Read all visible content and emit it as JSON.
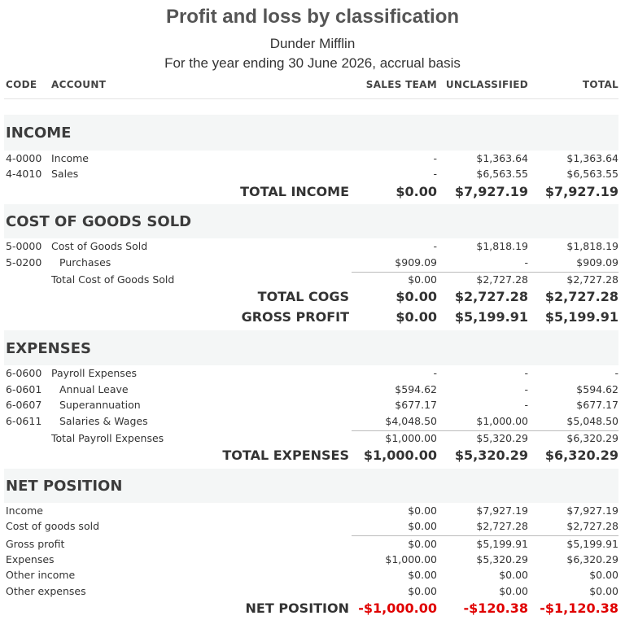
{
  "report": {
    "title": "Profit and loss by classification",
    "company": "Dunder Mifflin",
    "period": "For the year ending 30 June 2026, accrual basis"
  },
  "columns": {
    "code": "CODE",
    "account": "ACCOUNT",
    "sales_team": "SALES TEAM",
    "unclassified": "UNCLASSIFIED",
    "total": "TOTAL"
  },
  "income": {
    "title": "INCOME",
    "rows": [
      {
        "code": "4-0000",
        "account": "Income",
        "sales": "-",
        "uncl": "$1,363.64",
        "total": "$1,363.64"
      },
      {
        "code": "4-4010",
        "account": "Sales",
        "sales": "-",
        "uncl": "$6,563.55",
        "total": "$6,563.55"
      }
    ],
    "total": {
      "label": "TOTAL INCOME",
      "sales": "$0.00",
      "uncl": "$7,927.19",
      "total": "$7,927.19"
    }
  },
  "cogs": {
    "title": "COST OF GOODS SOLD",
    "rows": [
      {
        "code": "5-0000",
        "account": "Cost of Goods Sold",
        "sales": "-",
        "uncl": "$1,818.19",
        "total": "$1,818.19"
      },
      {
        "code": "5-0200",
        "account": "Purchases",
        "sales": "$909.09",
        "uncl": "-",
        "total": "$909.09"
      }
    ],
    "subtotal": {
      "account": "Total Cost of Goods Sold",
      "sales": "$0.00",
      "uncl": "$2,727.28",
      "total": "$2,727.28"
    },
    "total": {
      "label": "TOTAL COGS",
      "sales": "$0.00",
      "uncl": "$2,727.28",
      "total": "$2,727.28"
    },
    "gross": {
      "label": "GROSS PROFIT",
      "sales": "$0.00",
      "uncl": "$5,199.91",
      "total": "$5,199.91"
    }
  },
  "expenses": {
    "title": "EXPENSES",
    "rows": [
      {
        "code": "6-0600",
        "account": "Payroll Expenses",
        "sales": "-",
        "uncl": "-",
        "total": "-"
      },
      {
        "code": "6-0601",
        "account": "Annual Leave",
        "sales": "$594.62",
        "uncl": "-",
        "total": "$594.62"
      },
      {
        "code": "6-0607",
        "account": "Superannuation",
        "sales": "$677.17",
        "uncl": "-",
        "total": "$677.17"
      },
      {
        "code": "6-0611",
        "account": "Salaries & Wages",
        "sales": "$4,048.50",
        "uncl": "$1,000.00",
        "total": "$5,048.50"
      }
    ],
    "subtotal": {
      "account": "Total Payroll Expenses",
      "sales": "$1,000.00",
      "uncl": "$5,320.29",
      "total": "$6,320.29"
    },
    "total": {
      "label": "TOTAL EXPENSES",
      "sales": "$1,000.00",
      "uncl": "$5,320.29",
      "total": "$6,320.29"
    }
  },
  "net": {
    "title": "NET POSITION",
    "rows": [
      {
        "account": "Income",
        "sales": "$0.00",
        "uncl": "$7,927.19",
        "total": "$7,927.19"
      },
      {
        "account": "Cost of goods sold",
        "sales": "$0.00",
        "uncl": "$2,727.28",
        "total": "$2,727.28"
      },
      {
        "account": "Gross profit",
        "sales": "$0.00",
        "uncl": "$5,199.91",
        "total": "$5,199.91"
      },
      {
        "account": "Expenses",
        "sales": "$1,000.00",
        "uncl": "$5,320.29",
        "total": "$6,320.29"
      },
      {
        "account": "Other income",
        "sales": "$0.00",
        "uncl": "$0.00",
        "total": "$0.00"
      },
      {
        "account": "Other expenses",
        "sales": "$0.00",
        "uncl": "$0.00",
        "total": "$0.00"
      }
    ],
    "total": {
      "label": "NET POSITION",
      "sales": "-$1,000.00",
      "uncl": "-$120.38",
      "total": "-$1,120.38"
    }
  },
  "colors": {
    "negative": "#e00000",
    "band": "#f4f6f6"
  }
}
